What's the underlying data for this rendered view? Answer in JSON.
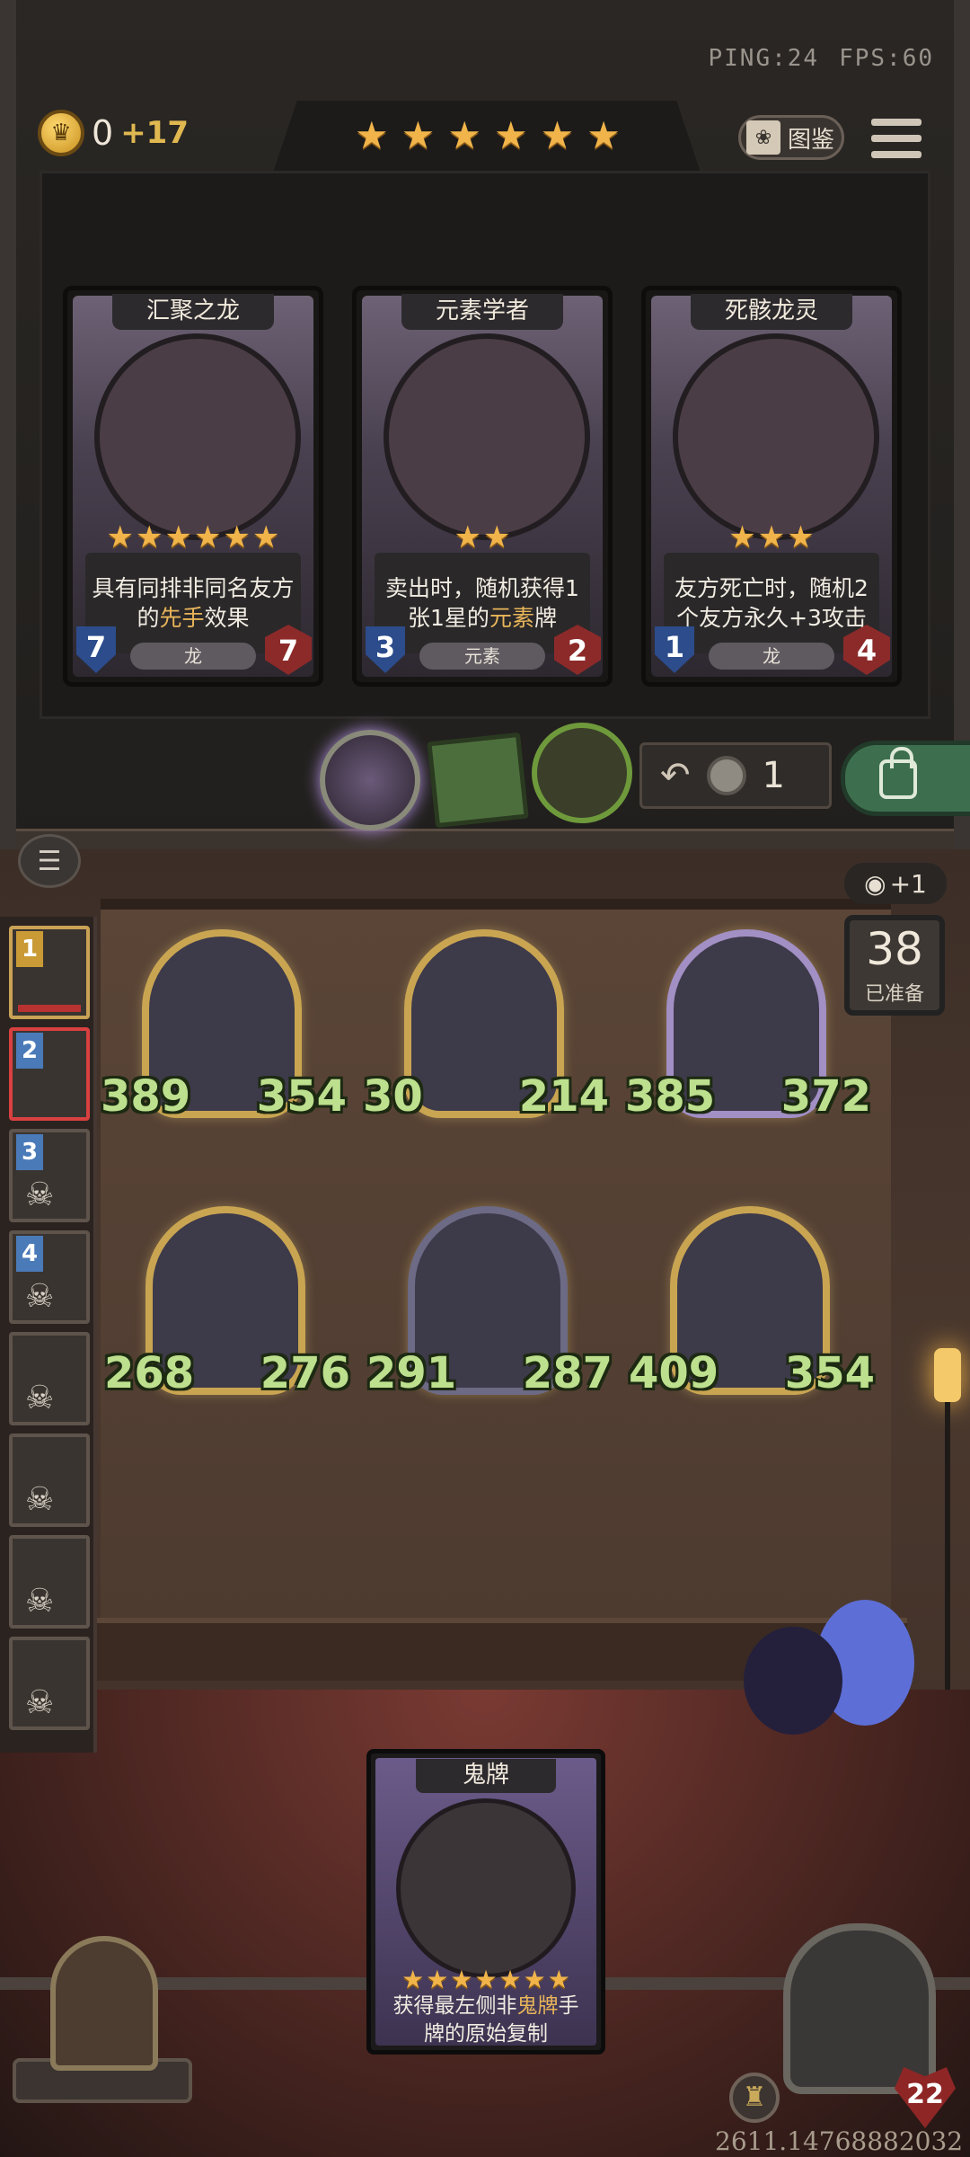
{
  "status": {
    "ping": "PING:24",
    "fps": "FPS:60"
  },
  "gold": {
    "amount": "0",
    "income": "+17"
  },
  "tavern_tier_stars": 6,
  "codex_label": "图鉴",
  "shop_cards": [
    {
      "name": "汇聚之龙",
      "stars": 6,
      "desc_before": "具有同排非同名友方的",
      "desc_highlight": "先手",
      "desc_after": "效果",
      "attack": "7",
      "health": "7",
      "tribe": "龙"
    },
    {
      "name": "元素学者",
      "stars": 2,
      "desc_before": "卖出时，随机获得1张1星的",
      "desc_highlight": "元素",
      "desc_after": "牌",
      "attack": "3",
      "health": "2",
      "tribe": "元素"
    },
    {
      "name": "死骸龙灵",
      "stars": 3,
      "desc_before": "友方死亡时，随机2个友方永久+3攻击",
      "desc_highlight": "",
      "desc_after": "",
      "attack": "1",
      "health": "4",
      "tribe": "龙"
    }
  ],
  "refresh_cost": "1",
  "view_bonus": "+1",
  "ready_count": "38",
  "ready_label": "已准备",
  "opponents": [
    {
      "rank": "1",
      "state": "first"
    },
    {
      "rank": "2",
      "state": "active"
    },
    {
      "rank": "3",
      "state": "dead"
    },
    {
      "rank": "4",
      "state": "dead"
    },
    {
      "rank": "",
      "state": "dead"
    },
    {
      "rank": "",
      "state": "dead"
    },
    {
      "rank": "",
      "state": "dead"
    },
    {
      "rank": "",
      "state": "dead"
    }
  ],
  "board_minions": [
    {
      "attack": "389",
      "health": "354",
      "frame": "gold"
    },
    {
      "attack": "30",
      "health": "214",
      "frame": "gold"
    },
    {
      "attack": "385",
      "health": "372",
      "frame": "purple"
    },
    {
      "attack": "268",
      "health": "276",
      "frame": "gold"
    },
    {
      "attack": "291",
      "health": "287",
      "frame": "silver"
    },
    {
      "attack": "409",
      "health": "354",
      "frame": "gold"
    }
  ],
  "hand_card": {
    "name": "鬼牌",
    "stars": 7,
    "desc_before": "获得最左侧非",
    "desc_highlight": "鬼牌",
    "desc_after": "手牌的原始复制"
  },
  "hero_health": "22",
  "player_id": "2611.14768882032",
  "colors": {
    "star": "#f0b44a",
    "stat_text": "#bde08e",
    "highlight": "#e8b55a",
    "hp_red": "#8c2a2a",
    "atk_blue": "#2c4c8c"
  }
}
